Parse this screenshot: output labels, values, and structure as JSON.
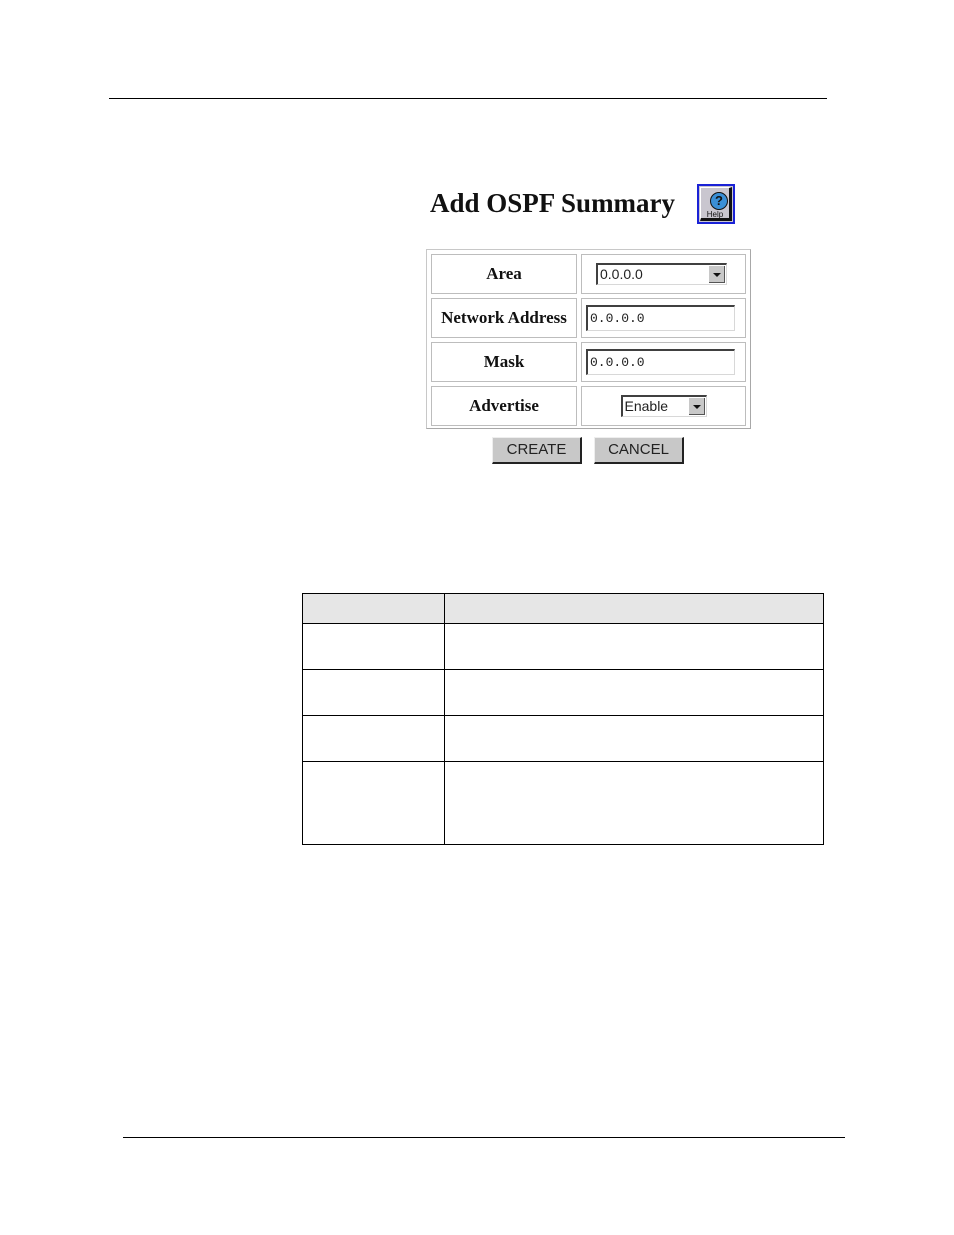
{
  "page": {
    "title": "Add OSPF Summary",
    "help_button": {
      "label": "Help",
      "icon": "question-mark-icon",
      "glyph": "?"
    }
  },
  "form": {
    "rows": [
      {
        "label": "Area",
        "control": "select",
        "value": "0.0.0.0"
      },
      {
        "label": "Network Address",
        "control": "text",
        "value": "0.0.0.0"
      },
      {
        "label": "Mask",
        "control": "text",
        "value": "0.0.0.0"
      },
      {
        "label": "Advertise",
        "control": "select",
        "value": "Enable"
      }
    ],
    "buttons": {
      "create": "CREATE",
      "cancel": "CANCEL"
    }
  },
  "description_table": {
    "headers": [
      "",
      ""
    ],
    "rows": [
      [
        "",
        ""
      ],
      [
        "",
        ""
      ],
      [
        "",
        ""
      ],
      [
        "",
        ""
      ]
    ]
  },
  "colors": {
    "help_border": "#1a22d6",
    "button_face": "#c8c8c8",
    "table_header_bg": "#e6e6e6"
  }
}
